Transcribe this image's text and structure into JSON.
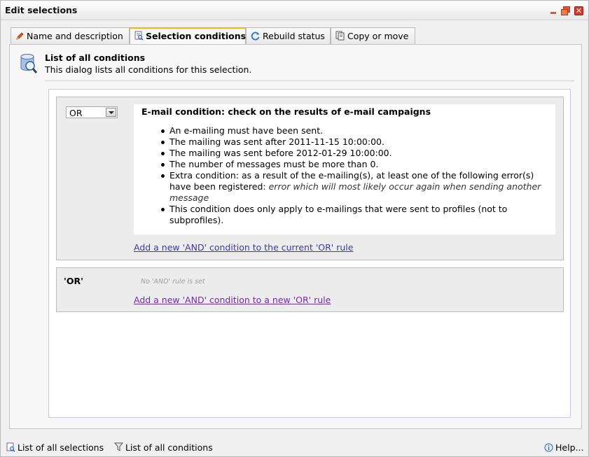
{
  "window": {
    "title": "Edit selections"
  },
  "tabs": [
    {
      "label": "Name and description",
      "icon": "pencil-icon",
      "active": false
    },
    {
      "label": "Selection conditions",
      "icon": "document-search-icon",
      "active": true
    },
    {
      "label": "Rebuild status",
      "icon": "refresh-icon",
      "active": false
    },
    {
      "label": "Copy or move",
      "icon": "copy-icon",
      "active": false
    }
  ],
  "header": {
    "icon": "database-search-icon",
    "title": "List of all conditions",
    "description": "This dialog lists all conditions for this selection."
  },
  "rules": [
    {
      "operator": "OR",
      "condition": {
        "title": "E-mail condition: check on the results of e-mail campaigns",
        "items": [
          "An e-mailing must have been sent.",
          "The mailing was sent after 2011-11-15 10:00:00.",
          "The mailing was sent before 2012-01-29 10:00:00.",
          "The number of messages must be more than 0.",
          "Extra condition: as a result of the e-mailing(s), at least one of the following error(s) have been registered:",
          "This condition does only apply to e-mailings that were sent to profiles (not to subprofiles)."
        ],
        "extra_detail": "error which will most likely occur again when sending another message"
      },
      "add_link": "Add a new 'AND' condition to the current 'OR' rule"
    }
  ],
  "new_or": {
    "label": "'OR'",
    "empty_text": "No 'AND' rule is set",
    "add_link": "Add a new 'AND' condition to a new 'OR' rule"
  },
  "statusbar": {
    "list_selections": "List of all selections",
    "list_conditions": "List of all conditions",
    "help": "Help..."
  },
  "colors": {
    "accent": "#f5b40a",
    "link": "#3a3aa8",
    "visited_link": "#7030a0",
    "close": "#d63a2a"
  }
}
